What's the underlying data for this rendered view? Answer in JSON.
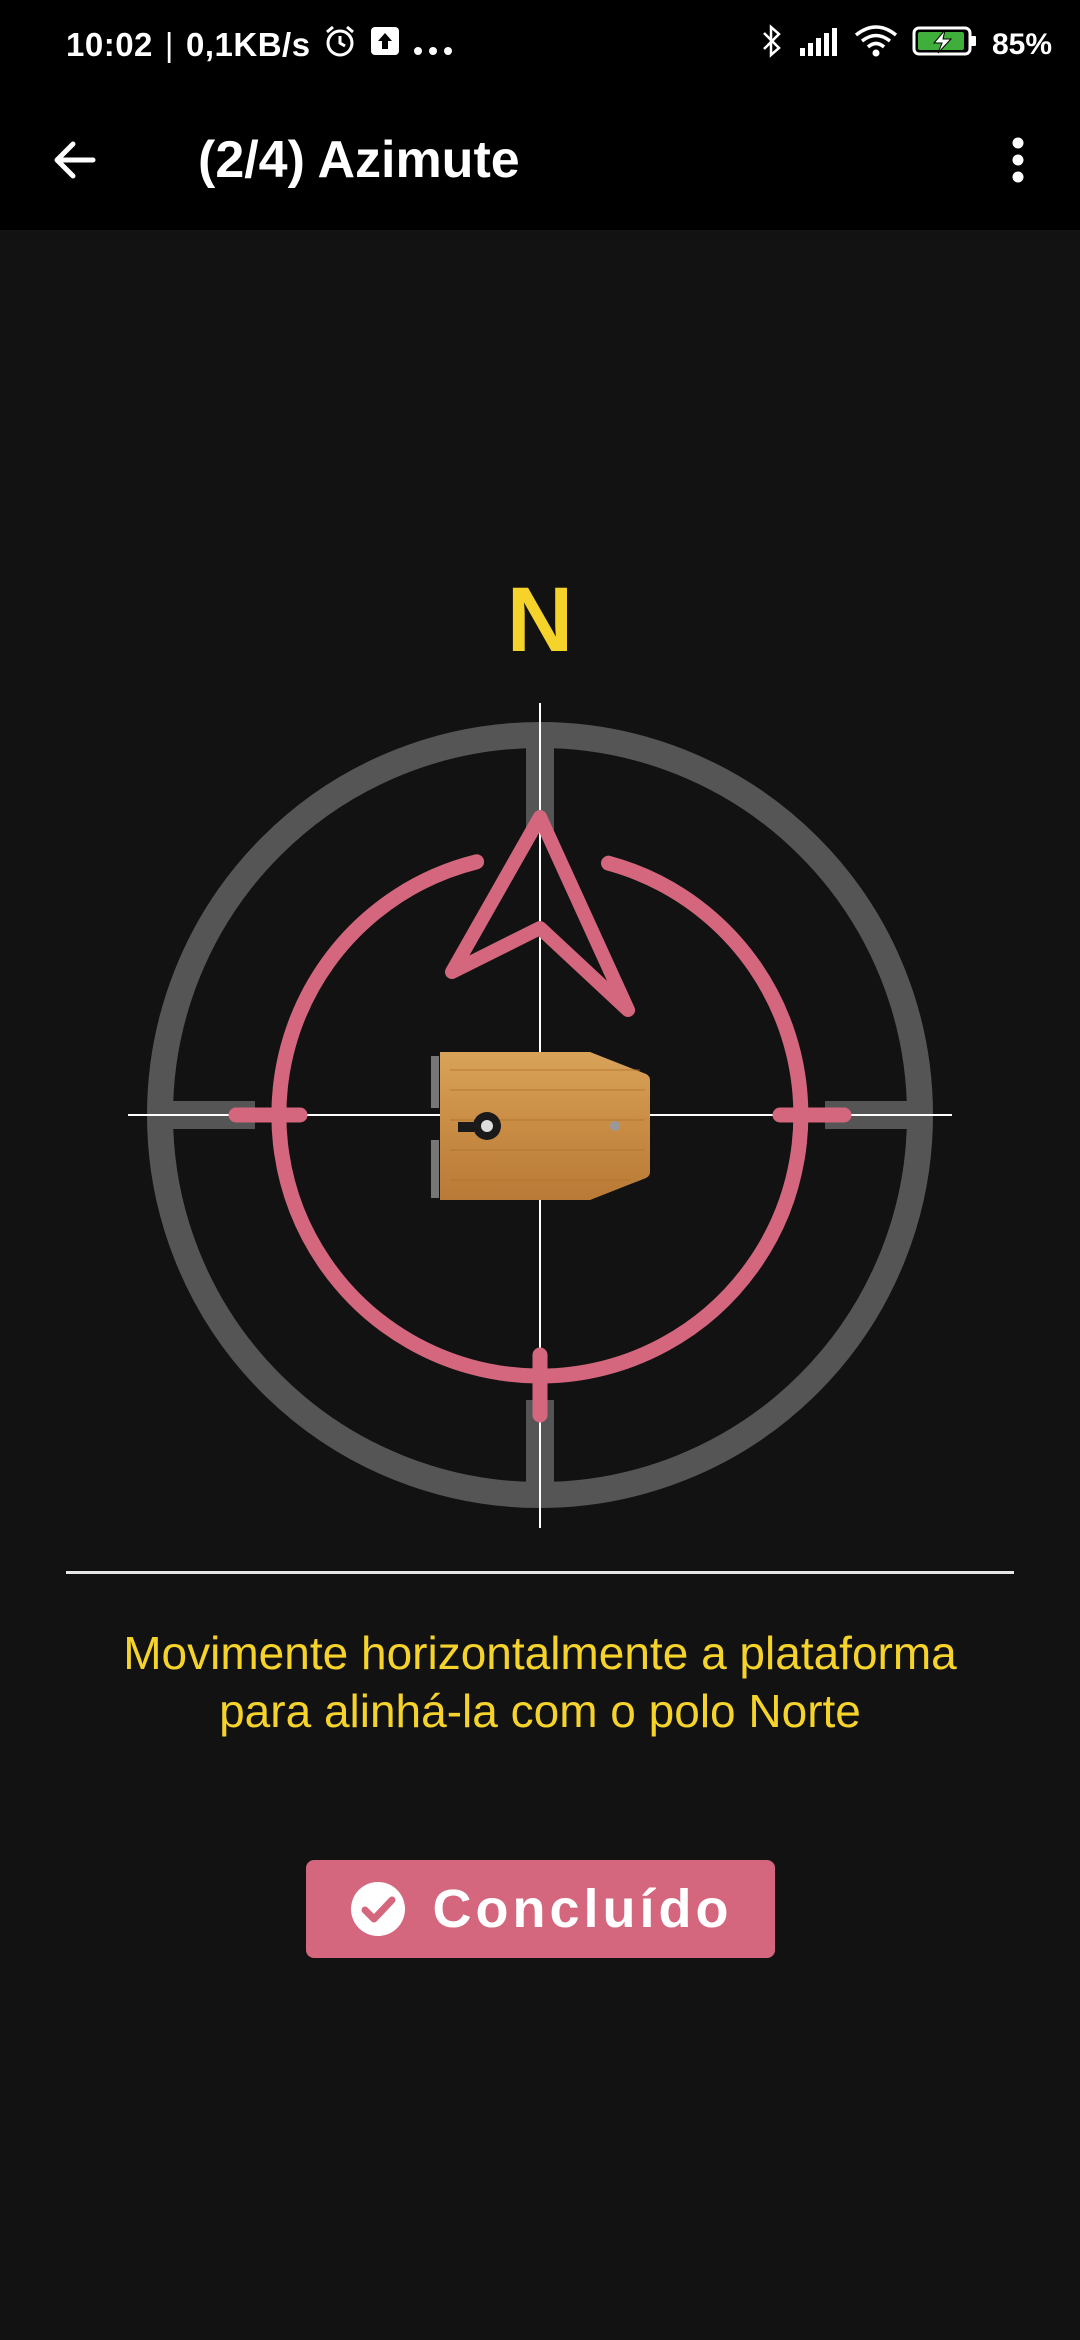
{
  "status_bar": {
    "time": "10:02",
    "net_speed": "0,1KB/s",
    "battery": "85%",
    "icons": [
      "alarm-icon",
      "upload-icon",
      "more-notifications-icon",
      "bluetooth-icon",
      "signal-icon",
      "wifi-icon",
      "battery-charging-icon"
    ]
  },
  "app_bar": {
    "title": "(2/4) Azimute",
    "back_icon": "arrow-back-icon",
    "menu_icon": "more-vert-icon"
  },
  "compass": {
    "north_label": "N",
    "colors": {
      "outer_ring": "#555555",
      "target_ring": "#d4677d",
      "north_label": "#f5d32b",
      "crosshair": "#ffffff"
    }
  },
  "instruction_text": "Movimente horizontalmente a plataforma para alinhá-la com o polo Norte",
  "done_button": {
    "label": "Concluído",
    "icon": "check-circle-icon",
    "color": "#d4677d"
  }
}
